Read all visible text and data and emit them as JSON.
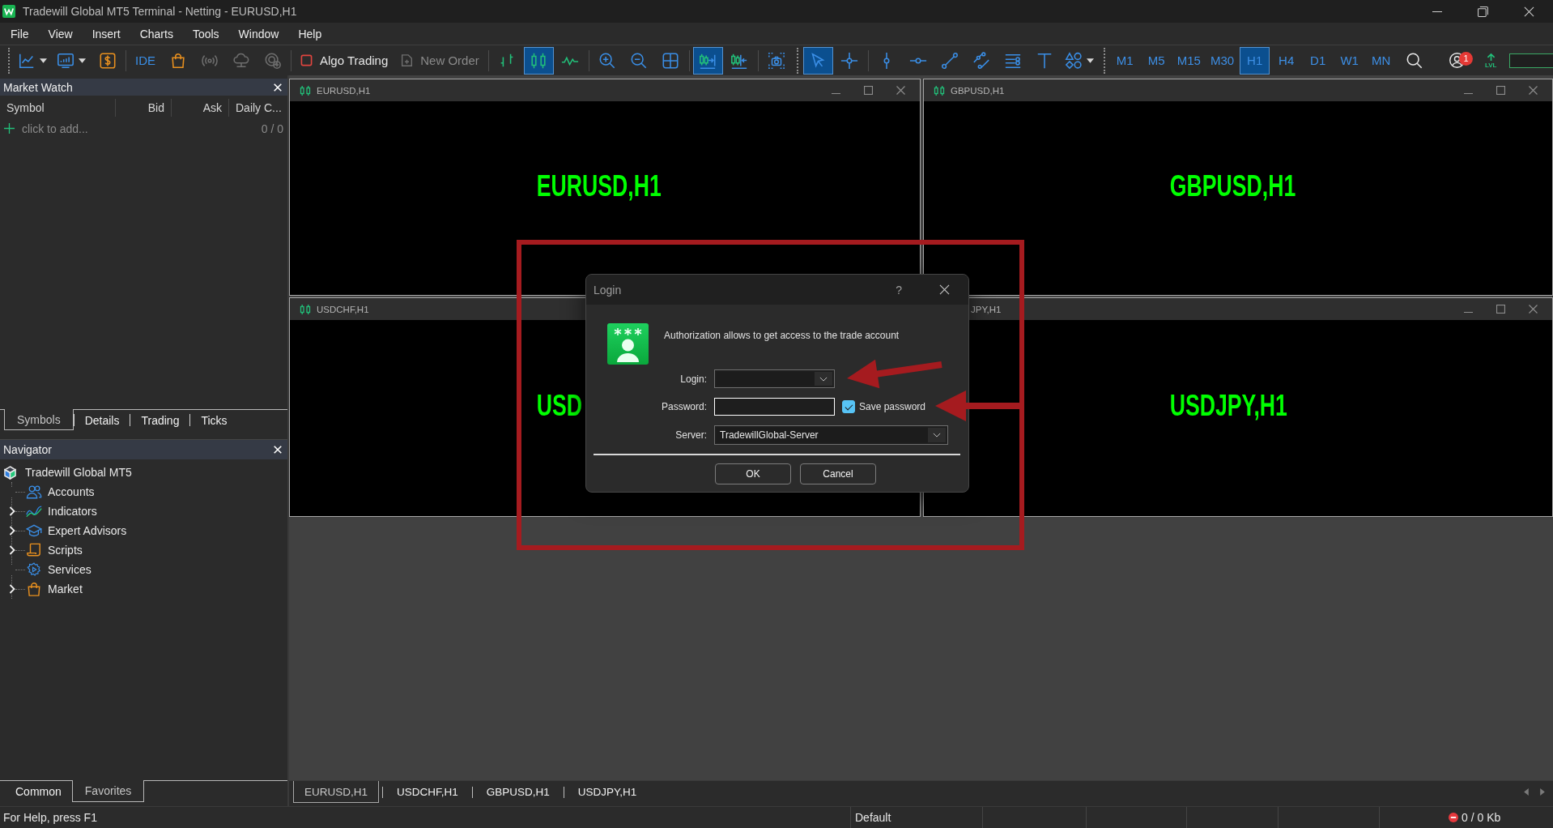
{
  "window": {
    "title": "Tradewill Global MT5 Terminal - Netting - EURUSD,H1"
  },
  "menu": [
    "File",
    "View",
    "Insert",
    "Charts",
    "Tools",
    "Window",
    "Help"
  ],
  "toolbars": [
    {
      "groups": [
        {
          "items": [
            {
              "kind": "linechart",
              "dropdown": true
            },
            {
              "kind": "template",
              "dropdown": true
            },
            {
              "kind": "dollar",
              "dropdown": false
            }
          ]
        },
        {
          "items": [
            {
              "kind": "ide",
              "label": "IDE",
              "disabled": false
            },
            {
              "kind": "market",
              "disabled": false
            },
            {
              "kind": "signals",
              "disabled": true
            },
            {
              "kind": "vps",
              "disabled": true
            },
            {
              "kind": "target",
              "disabled": true
            }
          ]
        },
        {
          "items": [
            {
              "kind": "algo",
              "label": "Algo Trading",
              "on": false,
              "disabled": false
            },
            {
              "kind": "order",
              "label": "New Order",
              "disabled": true
            }
          ]
        },
        {
          "items": [
            {
              "kind": "bars",
              "selected": false
            },
            {
              "kind": "candles",
              "selected": true
            },
            {
              "kind": "line",
              "selected": false
            }
          ]
        },
        {
          "items": [
            {
              "kind": "zoomin"
            },
            {
              "kind": "zoomout"
            },
            {
              "kind": "tile"
            }
          ]
        },
        {
          "items": [
            {
              "kind": "shift",
              "on": true
            },
            {
              "kind": "autoscroll",
              "on": false
            }
          ]
        },
        {
          "items": [
            {
              "kind": "screenshot"
            }
          ]
        }
      ]
    },
    {
      "groups": [
        {
          "items": [
            {
              "kind": "cursor",
              "selected": true
            },
            {
              "kind": "crosshair",
              "selected": false
            }
          ]
        },
        {
          "items": [
            {
              "kind": "vline",
              "dropdown": false
            },
            {
              "kind": "hline",
              "dropdown": false
            },
            {
              "kind": "trend",
              "dropdown": false
            },
            {
              "kind": "channel",
              "dropdown": false
            },
            {
              "kind": "fibo",
              "dropdown": false
            },
            {
              "kind": "texttool",
              "dropdown": false
            },
            {
              "kind": "shapes",
              "dropdown": true
            }
          ]
        }
      ]
    },
    {
      "groups": [
        {
          "items": [
            {
              "kind": "timeframe",
              "label": "M1",
              "selected": false
            },
            {
              "kind": "timeframe",
              "label": "M5",
              "selected": false
            },
            {
              "kind": "timeframe",
              "label": "M15",
              "selected": false
            },
            {
              "kind": "timeframe",
              "label": "M30",
              "selected": false
            },
            {
              "kind": "timeframe",
              "label": "H1",
              "selected": true
            },
            {
              "kind": "timeframe",
              "label": "H4",
              "selected": false
            },
            {
              "kind": "timeframe",
              "label": "D1",
              "selected": false
            },
            {
              "kind": "timeframe",
              "label": "W1",
              "selected": false
            },
            {
              "kind": "timeframe",
              "label": "MN",
              "selected": false
            }
          ]
        }
      ]
    }
  ],
  "toolbar_right": [
    {
      "kind": "search"
    },
    {
      "kind": "account",
      "badge": "1"
    },
    {
      "kind": "lvl",
      "label": "LVL"
    },
    {
      "kind": "meter"
    }
  ],
  "market_watch": {
    "title": "Market Watch",
    "columns": [
      "Symbol",
      "Bid",
      "Ask",
      "Daily C..."
    ],
    "add_row": {
      "label": "click to add...",
      "count": "0 / 0"
    },
    "tabs": [
      {
        "label": "Symbols",
        "selected": true
      },
      {
        "label": "Details",
        "selected": false
      },
      {
        "label": "Trading",
        "selected": false
      },
      {
        "label": "Ticks",
        "selected": false
      }
    ]
  },
  "navigator": {
    "title": "Navigator",
    "tree": [
      {
        "label": "Tradewill Global MT5",
        "kind": "broker",
        "children": [
          {
            "label": "Accounts",
            "kind": "accounts",
            "expandable": false,
            "expanded": false
          },
          {
            "label": "Indicators",
            "kind": "indicators",
            "expandable": true,
            "expanded": false
          },
          {
            "label": "Expert Advisors",
            "kind": "experts",
            "expandable": true,
            "expanded": false
          },
          {
            "label": "Scripts",
            "kind": "scripts",
            "expandable": true,
            "expanded": false
          },
          {
            "label": "Services",
            "kind": "services",
            "expandable": false,
            "expanded": false
          },
          {
            "label": "Market",
            "kind": "market",
            "expandable": true,
            "expanded": false
          }
        ]
      }
    ],
    "tabs": [
      {
        "label": "Common",
        "selected": false
      },
      {
        "label": "Favorites",
        "selected": true
      }
    ]
  },
  "charts": [
    {
      "title": "EURUSD,H1",
      "label": "EURUSD,H1",
      "title_icon": true,
      "controls": true
    },
    {
      "title": "GBPUSD,H1",
      "label": "GBPUSD,H1",
      "title_icon": true,
      "controls": true
    },
    {
      "title": "USDCHF,H1",
      "label": "USD",
      "title_icon": true,
      "controls": false
    },
    {
      "title": "JPY,H1",
      "label": "USDJPY,H1",
      "title_icon": false,
      "controls": true
    }
  ],
  "chart_tabs": [
    {
      "label": "EURUSD,H1",
      "selected": true
    },
    {
      "label": "USDCHF,H1",
      "selected": false
    },
    {
      "label": "GBPUSD,H1",
      "selected": false
    },
    {
      "label": "USDJPY,H1",
      "selected": false
    }
  ],
  "status_bar": {
    "help": "For Help, press F1",
    "profile": "Default",
    "connected": false,
    "traffic": "0 / 0 Kb"
  },
  "login_dialog": {
    "title": "Login",
    "help": "?",
    "message": "Authorization allows to get access to the trade account",
    "fields": [
      {
        "kind": "combo",
        "label": "Login:",
        "focused": false
      },
      {
        "kind": "password",
        "label": "Password:",
        "focused": true,
        "option": {
          "label": "Save password",
          "checked": true
        }
      },
      {
        "kind": "combo",
        "label": "Server:",
        "value": "TradewillGlobal-Server",
        "focused": false
      }
    ],
    "buttons": [
      "OK",
      "Cancel"
    ]
  },
  "annotations": [
    {
      "kind": "frame"
    },
    {
      "kind": "arrow"
    },
    {
      "kind": "arrow"
    }
  ]
}
